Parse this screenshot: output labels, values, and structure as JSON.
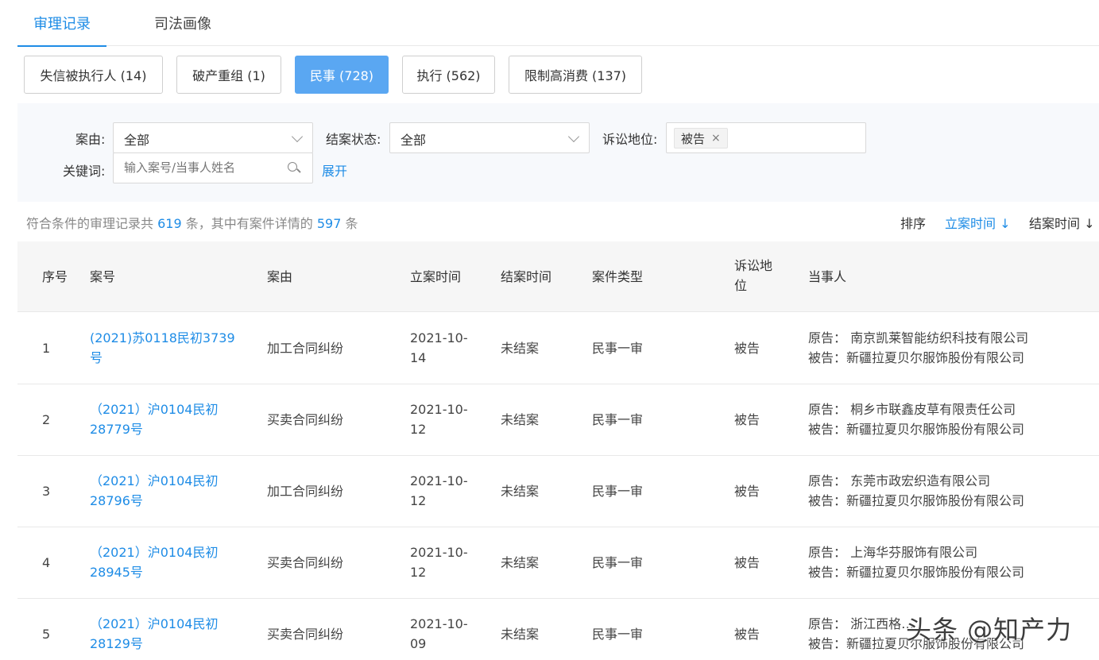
{
  "tabs": [
    {
      "label": "审理记录",
      "active": true
    },
    {
      "label": "司法画像",
      "active": false
    }
  ],
  "filter_buttons": [
    {
      "label": "失信被执行人 (14)",
      "active": false
    },
    {
      "label": "破产重组 (1)",
      "active": false
    },
    {
      "label": "民事 (728)",
      "active": true
    },
    {
      "label": "执行 (562)",
      "active": false
    },
    {
      "label": "限制高消费 (137)",
      "active": false
    }
  ],
  "filters": {
    "cause_label": "案由:",
    "cause_value": "全部",
    "status_label": "结案状态:",
    "status_value": "全部",
    "role_label": "诉讼地位:",
    "role_tag": "被告",
    "role_tag_remove": "×",
    "keyword_label": "关键词:",
    "keyword_placeholder": "输入案号/当事人姓名",
    "expand": "展开"
  },
  "summary": {
    "prefix": "符合条件的审理记录共",
    "total": "619",
    "middle": "条，其中有案件详情的",
    "detailed": "597",
    "suffix": "条"
  },
  "sort": {
    "label": "排序",
    "filed": "立案时间 ↓",
    "closed": "结案时间 ↓"
  },
  "table": {
    "headers": {
      "idx": "序号",
      "case": "案号",
      "cause": "案由",
      "filed": "立案时间",
      "closed": "结案时间",
      "type": "案件类型",
      "role": "诉讼地位",
      "party": "当事人"
    },
    "rows": [
      {
        "idx": "1",
        "case": "(2021)苏0118民初3739号",
        "cause": "加工合同纠纷",
        "filed": "2021-10-14",
        "closed": "未结案",
        "type": "民事一审",
        "role": "被告",
        "plaintiff": "原告：  南京凯莱智能纺织科技有限公司",
        "defendant": "被告：新疆拉夏贝尔服饰股份有限公司"
      },
      {
        "idx": "2",
        "case": "（2021）沪0104民初28779号",
        "cause": "买卖合同纠纷",
        "filed": "2021-10-12",
        "closed": "未结案",
        "type": "民事一审",
        "role": "被告",
        "plaintiff": "原告：  桐乡市联鑫皮草有限责任公司",
        "defendant": "被告：新疆拉夏贝尔服饰股份有限公司"
      },
      {
        "idx": "3",
        "case": "（2021）沪0104民初28796号",
        "cause": "加工合同纠纷",
        "filed": "2021-10-12",
        "closed": "未结案",
        "type": "民事一审",
        "role": "被告",
        "plaintiff": "原告：  东莞市政宏织造有限公司",
        "defendant": "被告：新疆拉夏贝尔服饰股份有限公司"
      },
      {
        "idx": "4",
        "case": "（2021）沪0104民初28945号",
        "cause": "买卖合同纠纷",
        "filed": "2021-10-12",
        "closed": "未结案",
        "type": "民事一审",
        "role": "被告",
        "plaintiff": "原告：  上海华芬服饰有限公司",
        "defendant": "被告：新疆拉夏贝尔服饰股份有限公司"
      },
      {
        "idx": "5",
        "case": "（2021）沪0104民初28129号",
        "cause": "买卖合同纠纷",
        "filed": "2021-10-09",
        "closed": "未结案",
        "type": "民事一审",
        "role": "被告",
        "plaintiff": "原告：  浙江西格…",
        "defendant": "被告：新疆拉夏贝尔服饰股份有限公司"
      }
    ]
  },
  "watermark": "头条 @知产力"
}
